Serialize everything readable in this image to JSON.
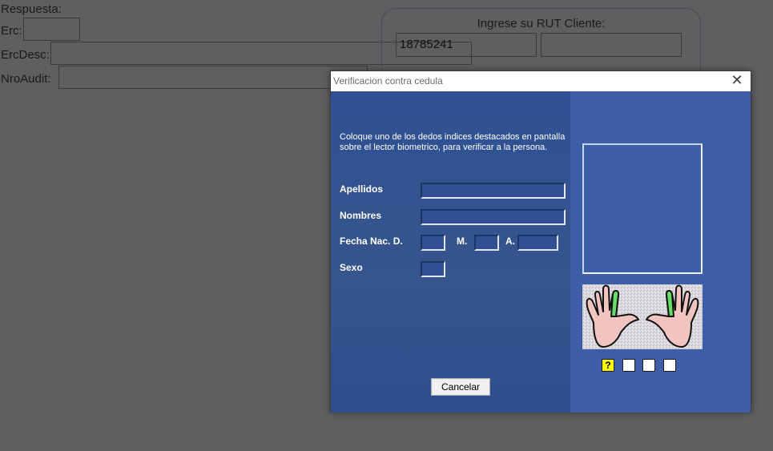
{
  "background_form": {
    "respuesta_label": "Respuesta:",
    "erc_label": "Erc:",
    "erc_value": "",
    "ercdesc_label": "ErcDesc:",
    "ercdesc_value": "",
    "nroaudit_label": "NroAudit:",
    "nroaudit_value": "",
    "rut_title": "Ingrese su RUT Cliente:",
    "rut_value": "18785241",
    "rut_dv_value": ""
  },
  "dialog": {
    "title": "Verificacion contra cedula",
    "close_glyph": "✕",
    "instructions": "Coloque uno de los dedos indices destacados en pantalla sobre el lector biometrico,  para verificar a la persona.",
    "apellidos_label": "Apellidos",
    "apellidos_value": "",
    "nombres_label": "Nombres",
    "nombres_value": "",
    "fecha_label": "Fecha Nac. D.",
    "dia_value": "",
    "mes_label": "M.",
    "mes_value": "",
    "anio_label": "A.",
    "anio_value": "",
    "sexo_label": "Sexo",
    "sexo_value": "",
    "cancel_label": "Cancelar",
    "attempt_marker": "?",
    "attempts": [
      "?",
      "",
      "",
      ""
    ],
    "highlighted_fingers": [
      "left-index",
      "right-index"
    ]
  },
  "colors": {
    "dim_background": "#5f5f5f",
    "left_pane": "#2f5194",
    "right_pane": "#3e5fa8",
    "finger_highlight": "#66dd66",
    "palm": "#f2c4c0",
    "attempt_current": "#ffff00"
  }
}
